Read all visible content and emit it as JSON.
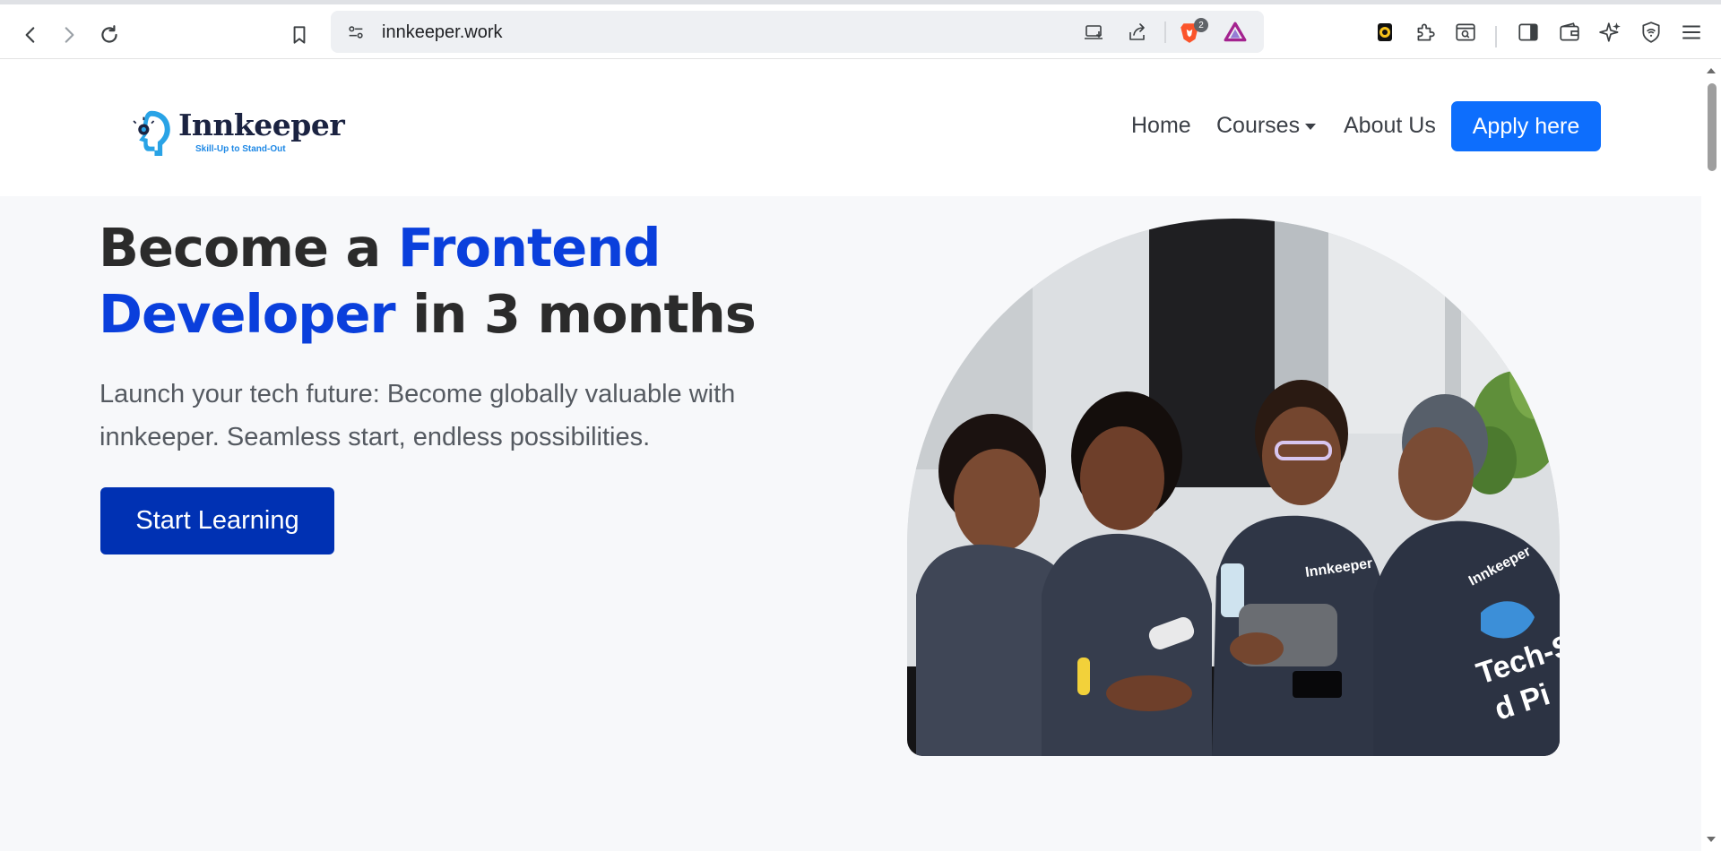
{
  "browser": {
    "url": "innkeeper.work",
    "brave_badge_count": "2"
  },
  "site": {
    "logo_name": "Innkeeper",
    "logo_tagline": "Skill-Up to Stand-Out",
    "nav": {
      "home": "Home",
      "courses": "Courses",
      "about": "About Us",
      "apply": "Apply here"
    }
  },
  "hero": {
    "title_part1": "Become a ",
    "title_highlight1": "Frontend",
    "title_highlight2": "Developer",
    "title_part2": " in 3 months",
    "subtitle": "Launch your tech future: Become globally valuable with innkeeper. Seamless start, endless possibilities.",
    "cta": "Start Learning",
    "photo_shirt_text": "Innkeeper",
    "photo_shirt_text2": "Tech-Sa",
    "photo_shirt_text3": "d Pi"
  },
  "colors": {
    "accent": "#0d6efd",
    "cta": "#0031b3",
    "highlight": "#0a3fdc"
  }
}
